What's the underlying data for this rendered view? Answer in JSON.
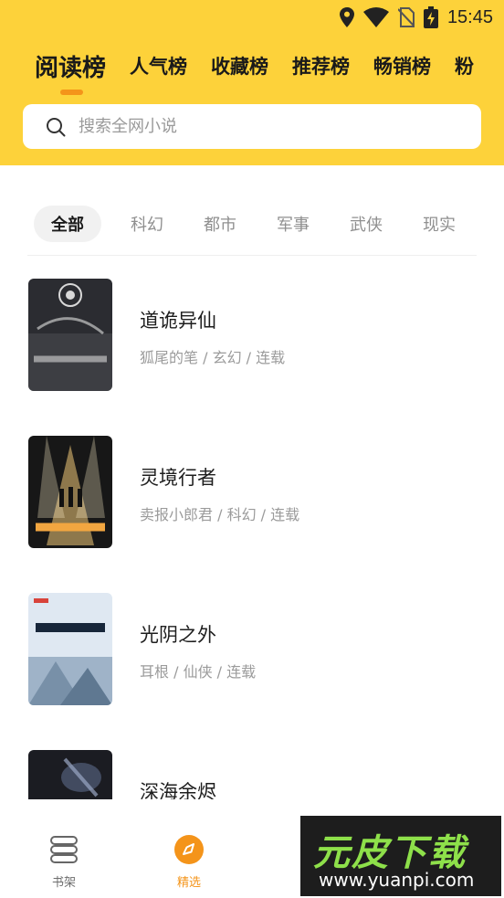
{
  "status_bar": {
    "time": "15:45",
    "icons": [
      "location-icon",
      "wifi-icon",
      "no-sim-icon",
      "battery-charging-icon"
    ]
  },
  "rank_tabs": [
    {
      "label": "阅读榜",
      "active": true
    },
    {
      "label": "人气榜",
      "active": false
    },
    {
      "label": "收藏榜",
      "active": false
    },
    {
      "label": "推荐榜",
      "active": false
    },
    {
      "label": "畅销榜",
      "active": false
    },
    {
      "label": "粉",
      "active": false
    }
  ],
  "search": {
    "placeholder": "搜索全网小说",
    "icon": "search-icon"
  },
  "categories": [
    {
      "label": "全部",
      "active": true
    },
    {
      "label": "科幻",
      "active": false
    },
    {
      "label": "都市",
      "active": false
    },
    {
      "label": "军事",
      "active": false
    },
    {
      "label": "武侠",
      "active": false
    },
    {
      "label": "现实",
      "active": false
    }
  ],
  "books": [
    {
      "title": "道诡异仙",
      "meta": "狐尾的笔 / 玄幻 / 连载"
    },
    {
      "title": "灵境行者",
      "meta": "卖报小郎君 / 科幻 / 连载"
    },
    {
      "title": "光阴之外",
      "meta": "耳根 / 仙侠 / 连载"
    },
    {
      "title": "深海余烬",
      "meta": ""
    }
  ],
  "bottom_nav": [
    {
      "label": "书架",
      "icon": "bookshelf-icon",
      "active": false
    },
    {
      "label": "精选",
      "icon": "compass-icon",
      "active": true
    }
  ],
  "watermark": {
    "logo": "元皮下载",
    "url": "www.yuanpi.com"
  },
  "colors": {
    "header_bg": "#fdd23a",
    "accent": "#f4941a"
  }
}
